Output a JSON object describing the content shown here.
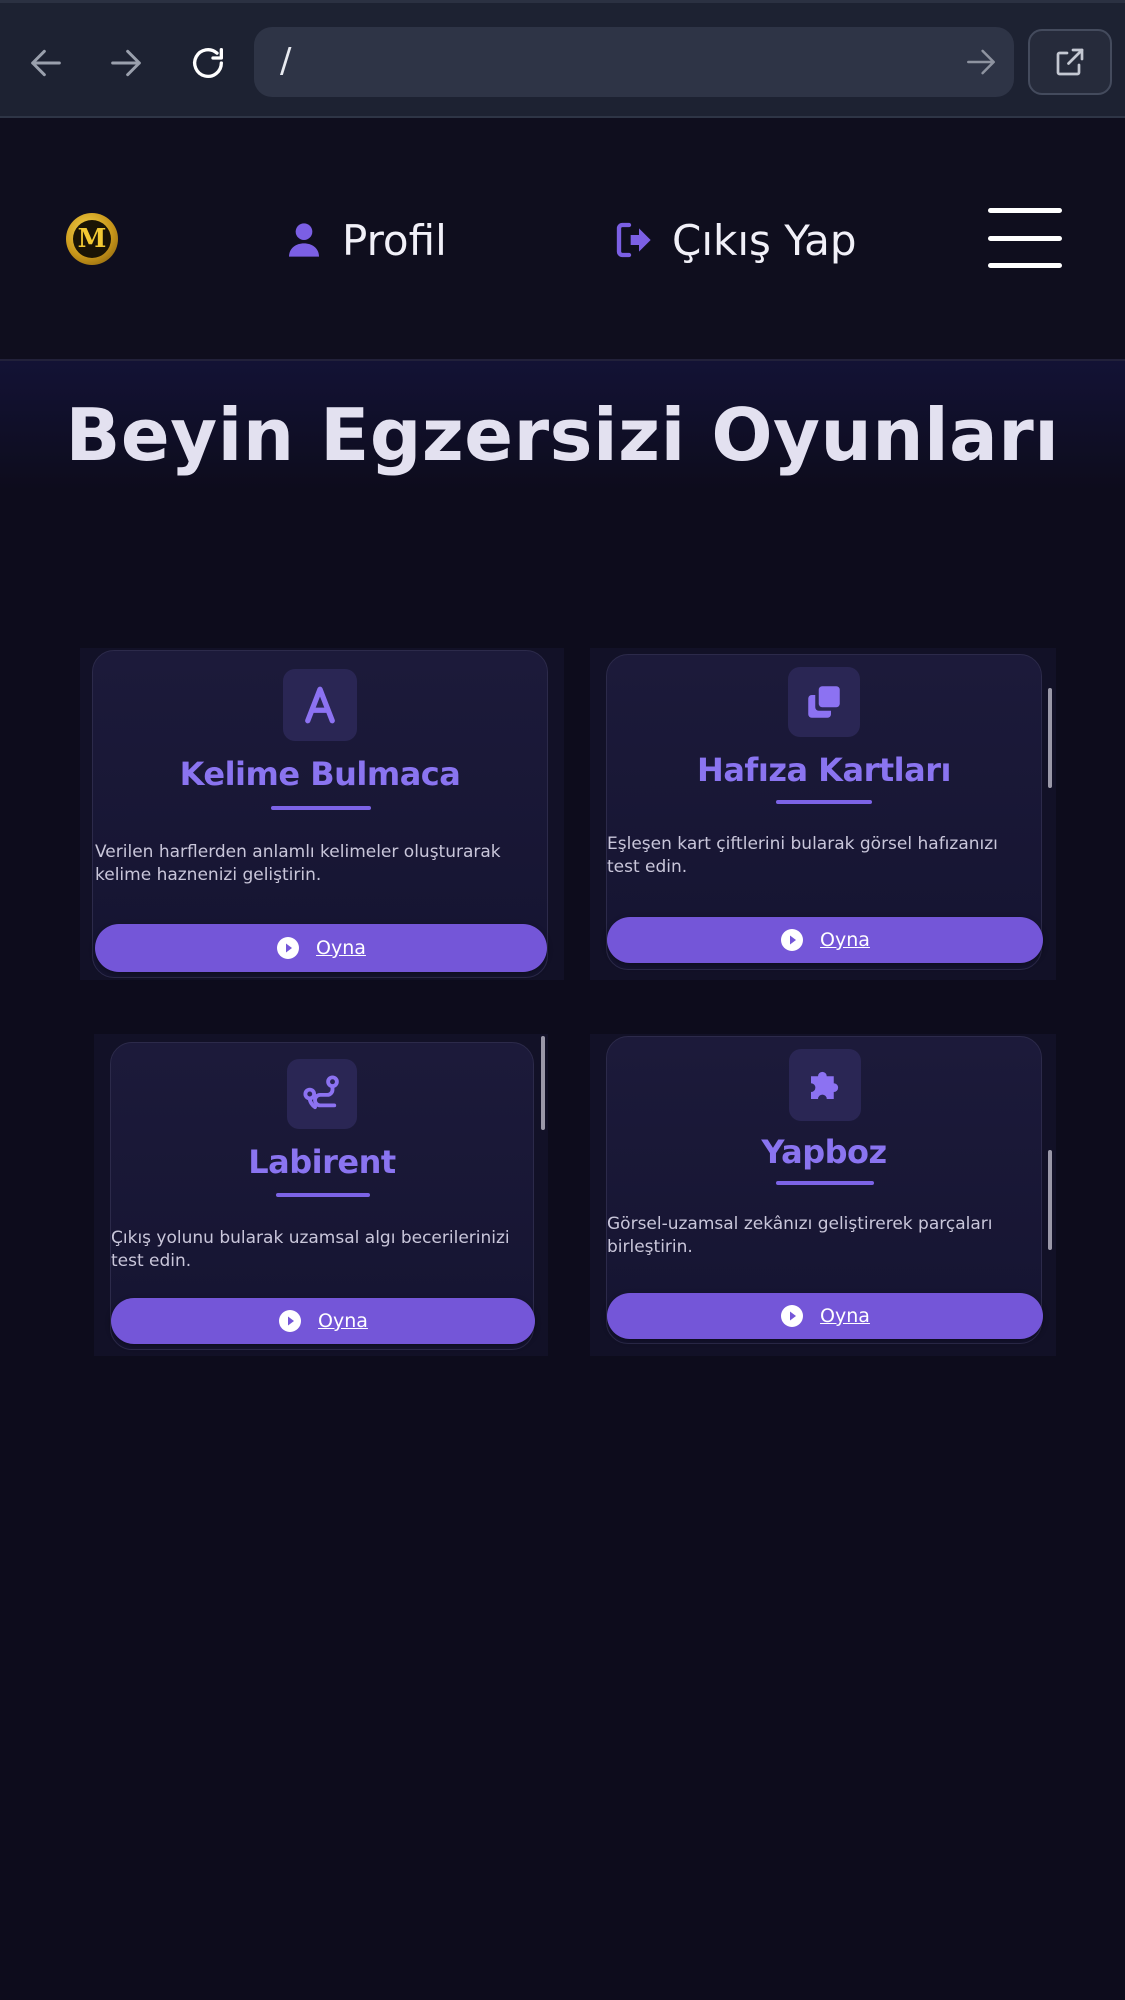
{
  "browser": {
    "url": "/"
  },
  "header": {
    "logo_letter": "M",
    "profile_label": "Profil",
    "logout_label": "Çıkış Yap"
  },
  "main": {
    "title": "Beyin Egzersizi Oyunları"
  },
  "games": [
    {
      "title": "Kelime Bulmaca",
      "icon": "letter-a-icon",
      "description": "Verilen harflerden anlamlı kelimeler oluşturarak kelime haznenizi geliştirin.",
      "button_label": "Oyna"
    },
    {
      "title": "Hafıza Kartları",
      "icon": "cards-clone-icon",
      "description": "Eşleşen kart çiftlerini bularak görsel hafızanızı test edin.",
      "button_label": "Oyna"
    },
    {
      "title": "Labirent",
      "icon": "route-icon",
      "description": "Çıkış yolunu bularak uzamsal algı becerilerinizi test edin.",
      "button_label": "Oyna"
    },
    {
      "title": "Yapboz",
      "icon": "puzzle-piece-icon",
      "description": "Görsel-uzamsal zekânızı geliştirerek parçaları birleştirin.",
      "button_label": "Oyna"
    }
  ],
  "colors": {
    "accent": "#7456d8",
    "title_accent": "#8a74f0",
    "background": "#0d0c1c"
  }
}
